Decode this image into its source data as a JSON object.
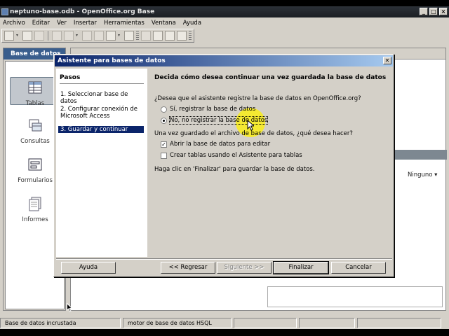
{
  "window": {
    "title": "neptuno-base.odb - OpenOffice.org Base",
    "controls": [
      "_",
      "□",
      "×"
    ]
  },
  "menubar": [
    "Archivo",
    "Editar",
    "Ver",
    "Insertar",
    "Herramientas",
    "Ventana",
    "Ayuda"
  ],
  "left_panel": {
    "header": "Base de datos",
    "items": [
      {
        "label": "Tablas",
        "icon": "table-icon",
        "selected": true
      },
      {
        "label": "Consultas",
        "icon": "query-icon",
        "selected": false
      },
      {
        "label": "Formularios",
        "icon": "form-icon",
        "selected": false
      },
      {
        "label": "Informes",
        "icon": "report-icon",
        "selected": false
      }
    ]
  },
  "right_pane": {
    "preview_select": "Ninguno ▾"
  },
  "statusbar": {
    "cells": [
      "Base de datos incrustada",
      "motor de base de datos HSQL",
      "",
      "",
      ""
    ]
  },
  "dialog": {
    "title": "Asistente para bases de datos",
    "steps_title": "Pasos",
    "steps": [
      "1. Seleccionar base de datos",
      "2. Configurar conexión de Microsoft Access",
      "3. Guardar y continuar"
    ],
    "active_step": 2,
    "heading": "Decida cómo desea continuar una vez guardada la base de datos",
    "register_question": "¿Desea que el asistente registre la base de datos en OpenOffice.org?",
    "radio_yes": "Sí, registrar la base de datos",
    "radio_no": "No, no registrar la base de datos",
    "radio_selected": "no",
    "after_save_question": "Una vez guardado el archivo de base de datos, ¿qué desea hacer?",
    "check_open": "Abrir la base de datos para editar",
    "check_open_checked": true,
    "check_create": "Crear tablas usando el Asistente para tablas",
    "check_create_checked": false,
    "finish_hint": "Haga clic en 'Finalizar' para guardar la base de datos.",
    "buttons": {
      "help": "Ayuda",
      "back": "<< Regresar",
      "next": "Siguiente >>",
      "finish": "Finalizar",
      "cancel": "Cancelar"
    }
  }
}
